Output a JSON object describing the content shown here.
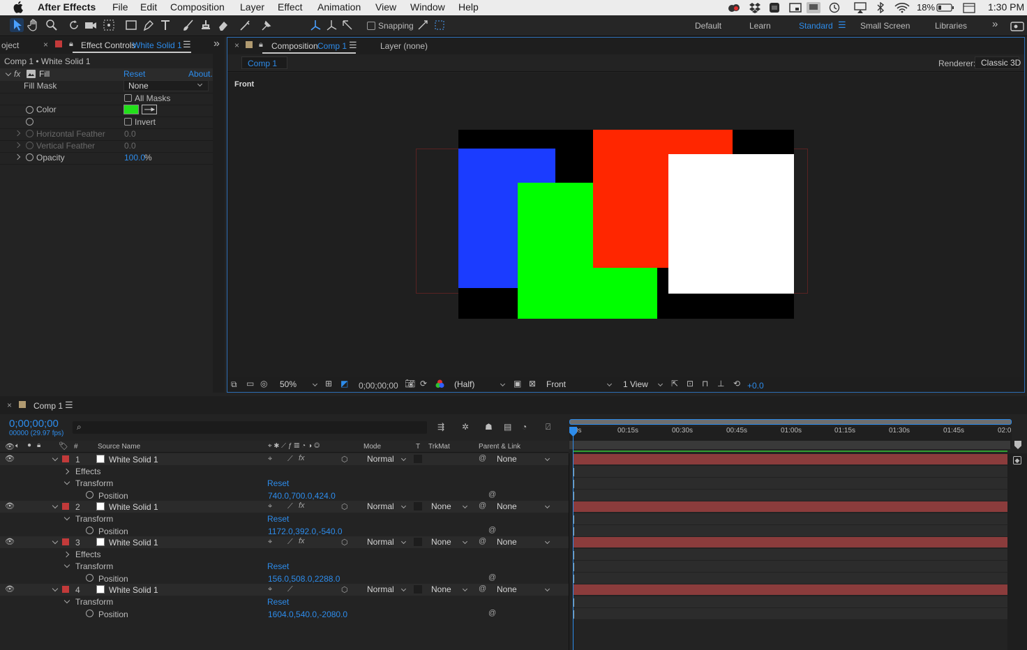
{
  "menubar": {
    "app": "After Effects",
    "items": [
      "File",
      "Edit",
      "Composition",
      "Layer",
      "Effect",
      "Animation",
      "View",
      "Window",
      "Help"
    ],
    "battery": "18%",
    "time": "1:30 PM"
  },
  "toolbar": {
    "snapping_label": "Snapping",
    "workspaces": [
      "Default",
      "Learn",
      "Standard",
      "Small Screen",
      "Libraries"
    ],
    "active_workspace": "Standard"
  },
  "effect_panel": {
    "tab_project_fragment": "oject",
    "tab_label": "Effect Controls",
    "tab_layer": "White Solid 1",
    "breadcrumb": "Comp 1 • White Solid 1",
    "effect_name": "Fill",
    "reset": "Reset",
    "about": "About.",
    "fill_mask_label": "Fill Mask",
    "fill_mask_value": "None",
    "all_masks": "All Masks",
    "color_label": "Color",
    "invert": "Invert",
    "h_feather_label": "Horizontal Feather",
    "h_feather_value": "0.0",
    "v_feather_label": "Vertical Feather",
    "v_feather_value": "0.0",
    "opacity_label": "Opacity",
    "opacity_value": "100.0",
    "opacity_unit": "%",
    "fill_color": "#22e01a"
  },
  "comp_panel": {
    "tab_label": "Composition",
    "tab_comp": "Comp 1",
    "layer_tab": "Layer (none)",
    "subtab": "Comp 1",
    "renderer_label": "Renderer:",
    "renderer_value": "Classic 3D",
    "view_name": "Front",
    "zoom": "50%",
    "timecode": "0;00;00;00",
    "resolution": "(Half)",
    "view_select": "Front",
    "views": "1 View",
    "exposure": "+0.0"
  },
  "timeline": {
    "tab_label": "Comp 1",
    "timecode": "0;00;00;00",
    "frames": "00000 (29.97 fps)",
    "col_num": "#",
    "col_source": "Source Name",
    "col_mode": "Mode",
    "col_t": "T",
    "col_trkmat": "TrkMat",
    "col_parent": "Parent & Link",
    "ruler": [
      "0s",
      "00:15s",
      "00:30s",
      "00:45s",
      "01:00s",
      "01:15s",
      "01:30s",
      "01:45s",
      "02:0"
    ],
    "layers": [
      {
        "num": "1",
        "name": "White Solid 1",
        "mode": "Normal",
        "trkmat": "",
        "parent": "None",
        "effects": "Effects",
        "transform": "Transform",
        "reset": "Reset",
        "position_label": "Position",
        "position": "740.0,700.0,424.0"
      },
      {
        "num": "2",
        "name": "White Solid 1",
        "mode": "Normal",
        "trkmat": "None",
        "parent": "None",
        "effects": "",
        "transform": "Transform",
        "reset": "Reset",
        "position_label": "Position",
        "position": "1172.0,392.0,-540.0"
      },
      {
        "num": "3",
        "name": "White Solid 1",
        "mode": "Normal",
        "trkmat": "None",
        "parent": "None",
        "effects": "Effects",
        "transform": "Transform",
        "reset": "Reset",
        "position_label": "Position",
        "position": "156.0,508.0,2288.0"
      },
      {
        "num": "4",
        "name": "White Solid 1",
        "mode": "Normal",
        "trkmat": "None",
        "parent": "None",
        "effects": "",
        "transform": "Transform",
        "reset": "Reset",
        "position_label": "Position",
        "position": "1604.0,540.0,-2080.0"
      }
    ]
  },
  "colors": {
    "accent": "#2d8ceb",
    "layer_bar": "#8b3c3c",
    "label": "#c23a3a",
    "solid_blue": "#1b3cff",
    "solid_green": "#00ff00",
    "solid_red": "#ff2600",
    "solid_white": "#ffffff"
  }
}
